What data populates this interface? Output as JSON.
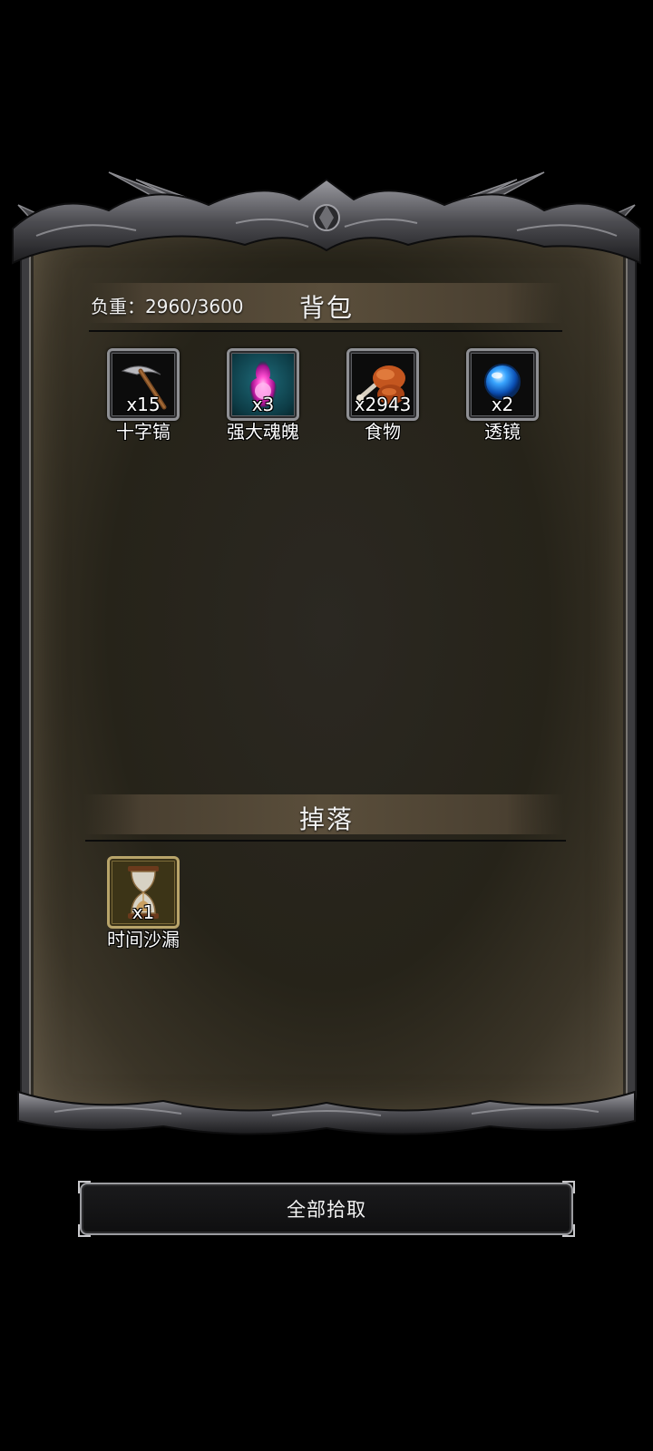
{
  "backpack": {
    "title": "背包",
    "weight_label": "负重：2960/3600",
    "items": [
      {
        "name": "十字镐",
        "qty": "x15",
        "icon": "pickaxe-icon"
      },
      {
        "name": "强大魂魄",
        "qty": "x3",
        "icon": "soul-orb-icon"
      },
      {
        "name": "食物",
        "qty": "x2943",
        "icon": "meat-icon"
      },
      {
        "name": "透镜",
        "qty": "x2",
        "icon": "lens-orb-icon"
      }
    ]
  },
  "drops": {
    "title": "掉落",
    "items": [
      {
        "name": "时间沙漏",
        "qty": "x1",
        "icon": "hourglass-icon"
      }
    ]
  },
  "actions": {
    "pick_all_label": "全部拾取"
  },
  "colors": {
    "background": "#000000",
    "panel": "#262319",
    "frame_metal": "#6b6b70",
    "header_bar": "#5a4e3b"
  }
}
